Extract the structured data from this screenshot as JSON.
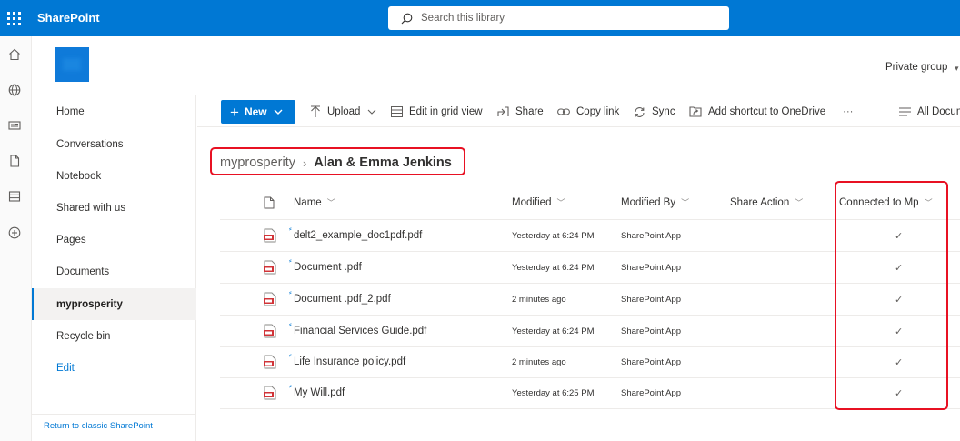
{
  "suite": {
    "brand": "SharePoint",
    "search_placeholder": "Search this library"
  },
  "icons": {
    "waffle": "app-launcher-icon",
    "rail": [
      "home-icon",
      "globe-icon",
      "news-icon",
      "document-icon",
      "list-icon",
      "add-icon"
    ]
  },
  "header": {
    "group_label": "Private group"
  },
  "nav": {
    "items": [
      {
        "label": "Home"
      },
      {
        "label": "Conversations"
      },
      {
        "label": "Notebook"
      },
      {
        "label": "Shared with us"
      },
      {
        "label": "Pages"
      },
      {
        "label": "Documents"
      },
      {
        "label": "myprosperity"
      },
      {
        "label": "Recycle bin"
      },
      {
        "label": "Edit"
      }
    ],
    "footer": "Return to classic SharePoint"
  },
  "commands": {
    "new": "New",
    "upload": "Upload",
    "grid_view": "Edit in grid view",
    "share": "Share",
    "copy_link": "Copy link",
    "sync": "Sync",
    "shortcut": "Add shortcut to OneDrive",
    "more": "···",
    "view": "All Docum"
  },
  "breadcrumb": {
    "root": "myprosperity",
    "current": "Alan & Emma Jenkins"
  },
  "table": {
    "columns": {
      "name": "Name",
      "modified": "Modified",
      "modified_by": "Modified By",
      "share_action": "Share Action",
      "connected": "Connected to Mp"
    },
    "rows": [
      {
        "name": "delt2_example_doc1pdf.pdf",
        "modified": "Yesterday at 6:24 PM",
        "modified_by": "SharePoint App",
        "connected": "✓"
      },
      {
        "name": "Document .pdf",
        "modified": "Yesterday at 6:24 PM",
        "modified_by": "SharePoint App",
        "connected": "✓"
      },
      {
        "name": "Document .pdf_2.pdf",
        "modified": "2 minutes ago",
        "modified_by": "SharePoint App",
        "connected": "✓"
      },
      {
        "name": "Financial Services Guide.pdf",
        "modified": "Yesterday at 6:24 PM",
        "modified_by": "SharePoint App",
        "connected": "✓"
      },
      {
        "name": "Life Insurance policy.pdf",
        "modified": "2 minutes ago",
        "modified_by": "SharePoint App",
        "connected": "✓"
      },
      {
        "name": "My Will.pdf",
        "modified": "Yesterday at 6:25 PM",
        "modified_by": "SharePoint App",
        "connected": "✓"
      }
    ]
  },
  "colors": {
    "brand": "#0078d4",
    "highlight": "#e81123"
  }
}
